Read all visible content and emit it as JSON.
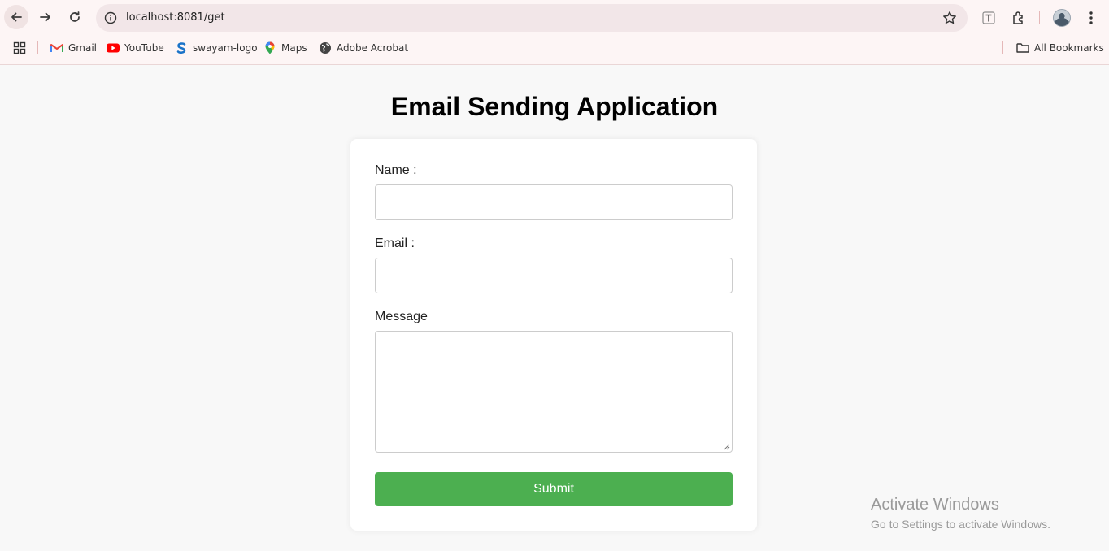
{
  "browser": {
    "url": "localhost:8081/get",
    "bookmarks": [
      {
        "label": "Gmail",
        "icon": "gmail-icon"
      },
      {
        "label": "YouTube",
        "icon": "youtube-icon"
      },
      {
        "label": "swayam-logo",
        "icon": "swayam-icon"
      },
      {
        "label": "Maps",
        "icon": "maps-icon"
      },
      {
        "label": "Adobe Acrobat",
        "icon": "globe-icon"
      }
    ],
    "all_bookmarks_label": "All Bookmarks"
  },
  "page": {
    "title": "Email Sending Application",
    "form": {
      "name_label": "Name :",
      "name_value": "",
      "email_label": "Email :",
      "email_value": "",
      "message_label": "Message",
      "message_value": "",
      "submit_label": "Submit",
      "submit_color": "#4caf50"
    }
  },
  "watermark": {
    "line1": "Activate Windows",
    "line2": "Go to Settings to activate Windows."
  }
}
